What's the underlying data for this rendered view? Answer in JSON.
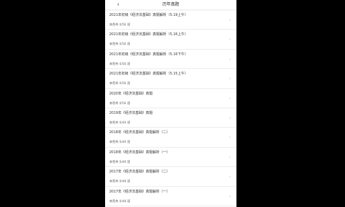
{
  "header": {
    "title": "历年真题"
  },
  "items": [
    {
      "title": "2021年初级《经济法基础》真题解析（5.19上午）",
      "count": "本卷共 0/56 道"
    },
    {
      "title": "2021年初级《经济法基础》真题解析（5.16上午）",
      "count": "本卷共 0/56 道"
    },
    {
      "title": "2021年初级《经济法基础》真题解析（5.16下午）",
      "count": "本卷共 0/56 道"
    },
    {
      "title": "2021年初级《经济法基础》真题解析（5.15上午）",
      "count": "本卷共 0/56 道"
    },
    {
      "title": "2020年《经济法基础》真题",
      "count": "本卷共 0/56 道"
    },
    {
      "title": "2019年《经济法基础》真题",
      "count": "本卷共 0/49 道"
    },
    {
      "title": "2018年《经济法基础》真题解析（二）",
      "count": "本卷共 0/49 道"
    },
    {
      "title": "2018年《经济法基础》真题解析（一）",
      "count": "本卷共 0/49 道"
    },
    {
      "title": "2017年《经济法基础》真题解析（二）",
      "count": "本卷共 0/48 道"
    },
    {
      "title": "2017年《经济法基础》真题解析（一）",
      "count": "本卷共 0/48 道"
    }
  ]
}
